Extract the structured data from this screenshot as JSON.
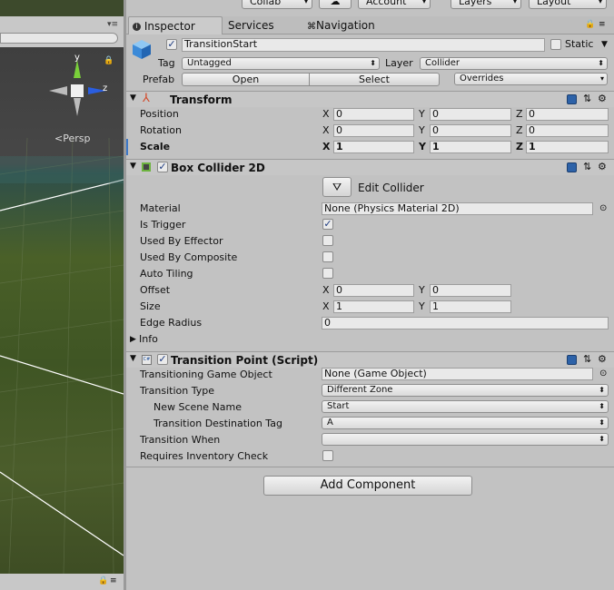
{
  "toolbar": {
    "collab_label": "Collab",
    "account_label": "Account",
    "layers_label": "Layers",
    "layout_label": "Layout"
  },
  "scene": {
    "persp_label": "Persp",
    "gizmo_y": "y",
    "gizmo_z": "z"
  },
  "tabs": [
    {
      "label": "Inspector"
    },
    {
      "label": "Services"
    },
    {
      "label": "Navigation"
    }
  ],
  "object": {
    "name": "TransitionStart",
    "static_label": "Static",
    "tag_label": "Tag",
    "tag_value": "Untagged",
    "layer_label": "Layer",
    "layer_value": "Collider",
    "prefab_label": "Prefab",
    "prefab_open": "Open",
    "prefab_select": "Select",
    "prefab_overrides": "Overrides"
  },
  "transform": {
    "title": "Transform",
    "rows": [
      {
        "label": "Position",
        "x": "0",
        "y": "0",
        "z": "0"
      },
      {
        "label": "Rotation",
        "x": "0",
        "y": "0",
        "z": "0"
      },
      {
        "label": "Scale",
        "x": "1",
        "y": "1",
        "z": "1"
      }
    ],
    "axis_x": "X",
    "axis_y": "Y",
    "axis_z": "Z"
  },
  "box_collider": {
    "title": "Box Collider 2D",
    "edit_collider": "Edit Collider",
    "material_label": "Material",
    "material_value": "None (Physics Material 2D)",
    "is_trigger": "Is Trigger",
    "used_by_effector": "Used By Effector",
    "used_by_composite": "Used By Composite",
    "auto_tiling": "Auto Tiling",
    "offset_label": "Offset",
    "offset_x": "0",
    "offset_y": "0",
    "size_label": "Size",
    "size_x": "1",
    "size_y": "1",
    "edge_radius_label": "Edge Radius",
    "edge_radius_value": "0",
    "info_label": "Info",
    "is_trigger_checked": true,
    "used_by_effector_checked": false,
    "used_by_composite_checked": false,
    "auto_tiling_checked": false
  },
  "transition_point": {
    "title": "Transition Point (Script)",
    "go_label": "Transitioning Game Object",
    "go_value": "None (Game Object)",
    "type_label": "Transition Type",
    "type_value": "Different Zone",
    "scene_label": "New Scene Name",
    "scene_value": "Start",
    "tag_label": "Transition Destination Tag",
    "tag_value": "A",
    "when_label": "Transition When",
    "when_value": "",
    "inventory_label": "Requires Inventory Check",
    "inventory_checked": false
  },
  "add_component": "Add Component",
  "colors": {
    "panel": "#c2c2c2",
    "accent": "#2d62a8"
  }
}
